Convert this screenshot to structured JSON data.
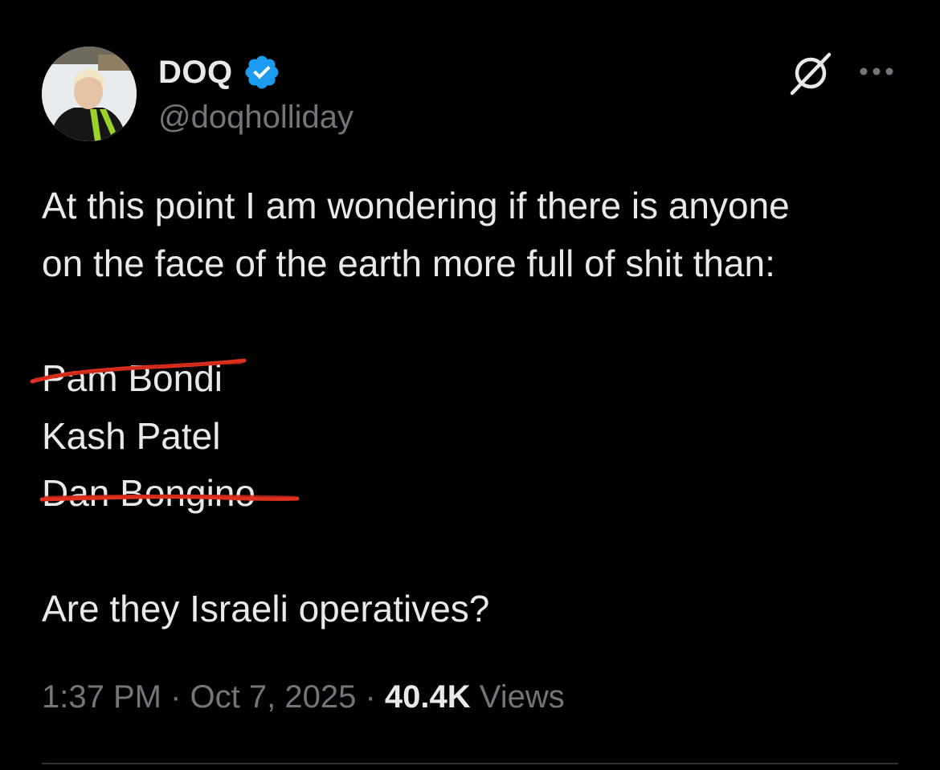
{
  "author": {
    "name": "DOQ",
    "handle": "@doqholliday",
    "verified": true
  },
  "tweet": {
    "line1": "At this point I am wondering if there is anyone",
    "line2": "on the face of the earth more full of shit than:",
    "names": [
      {
        "text": "Pam Bondi",
        "struck": true
      },
      {
        "text": "Kash Patel",
        "struck": false
      },
      {
        "text": "Dan Bongino",
        "struck": true
      }
    ],
    "question": "Are they Israeli operatives?"
  },
  "meta": {
    "time": "1:37 PM",
    "date": "Oct 7, 2025",
    "separator": "·",
    "views_count": "40.4K",
    "views_label": "Views"
  },
  "icons": {
    "verified": "verified-badge-icon",
    "grok": "grok-icon",
    "more": "more-options-icon"
  },
  "colors": {
    "background": "#000000",
    "text": "#e7e9ea",
    "secondary": "#71767b",
    "verified_blue": "#1d9bf0",
    "strike_red": "#e0301e",
    "divider": "#2f3336"
  }
}
